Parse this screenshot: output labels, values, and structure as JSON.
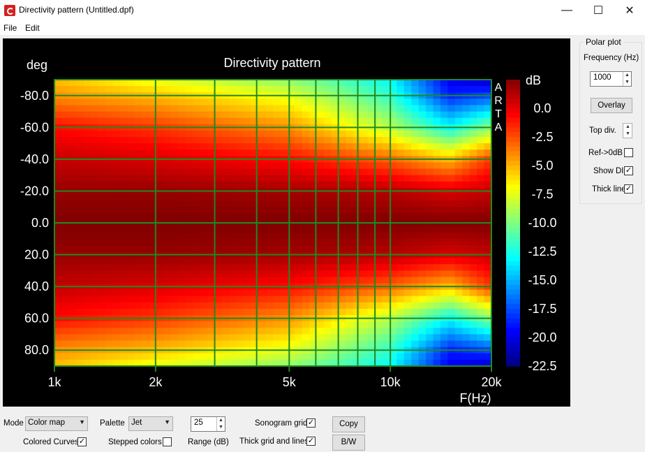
{
  "window": {
    "title": "Directivity pattern (Untitled.dpf)",
    "minimize_glyph": "—",
    "maximize_glyph": "☐",
    "close_glyph": "✕"
  },
  "menu": {
    "items": [
      "File",
      "Edit"
    ]
  },
  "chart_data": {
    "type": "heatmap",
    "title": "Directivity pattern",
    "ylabel": "deg",
    "xlabel": "F(Hz)",
    "watermark": "ARTA",
    "colorbar_label": "dB",
    "x_scale": "log",
    "xlim": [
      1000,
      20000
    ],
    "x_ticks": [
      1000,
      2000,
      5000,
      10000,
      20000
    ],
    "x_tick_labels": [
      "1k",
      "2k",
      "5k",
      "10k",
      "20k"
    ],
    "ylim": [
      -90,
      90
    ],
    "y_ticks": [
      -80,
      -60,
      -40,
      -20,
      0,
      20,
      40,
      60,
      80
    ],
    "y_tick_labels": [
      "-80.0",
      "-60.0",
      "-40.0",
      "-20.0",
      "0.0",
      "20.0",
      "40.0",
      "60.0",
      "80.0"
    ],
    "colorbar_range": [
      -22.5,
      0
    ],
    "colorbar_ticks": [
      "0.0",
      "-2.5",
      "-5.0",
      "-7.5",
      "-10.0",
      "-12.5",
      "-15.0",
      "-17.5",
      "-20.0",
      "-22.5"
    ],
    "palette": "Jet",
    "grid": true,
    "grid_color": "#1f8a1f",
    "freq_hz": [
      1000,
      2000,
      5000,
      10000,
      15000,
      20000
    ],
    "angles_deg": [
      -90,
      -80,
      -60,
      -40,
      -20,
      0,
      20,
      40,
      60,
      80,
      90
    ],
    "values_db": [
      [
        -7,
        -9,
        -11,
        -14,
        -20,
        -21
      ],
      [
        -6,
        -7,
        -9,
        -13,
        -19,
        -18
      ],
      [
        -3,
        -4,
        -6,
        -10,
        -14,
        -11
      ],
      [
        -1.5,
        -2,
        -3,
        -5,
        -7,
        -4
      ],
      [
        -0.5,
        -0.5,
        -0.8,
        -1.2,
        -2,
        -1.5
      ],
      [
        0,
        0,
        0,
        0,
        0,
        0
      ],
      [
        -0.5,
        -0.5,
        -0.8,
        -1.2,
        -2,
        -1.5
      ],
      [
        -1.5,
        -2,
        -3,
        -5,
        -7,
        -4
      ],
      [
        -3,
        -4,
        -6,
        -10,
        -14,
        -11
      ],
      [
        -6,
        -7,
        -9,
        -13,
        -19,
        -18
      ],
      [
        -7,
        -9,
        -11,
        -14,
        -20,
        -21
      ]
    ]
  },
  "polar_plot": {
    "title": "Polar plot",
    "frequency_label": "Frequency (Hz)",
    "frequency_value": "1000",
    "overlay_label": "Overlay",
    "top_div_label": "Top div.",
    "ref_0db_label": "Ref->0dB",
    "ref_0db_checked": false,
    "show_di_label": "Show DI",
    "show_di_checked": true,
    "thick_line_label": "Thick line",
    "thick_line_checked": true
  },
  "bottom": {
    "mode_label": "Mode",
    "mode_value": "Color map",
    "palette_label": "Palette",
    "palette_value": "Jet",
    "range_value": "25",
    "range_label": "Range (dB)",
    "sonogram_grid_label": "Sonogram grid",
    "sonogram_grid_checked": true,
    "copy_label": "Copy",
    "colored_curves_label": "Colored Curves",
    "colored_curves_checked": true,
    "stepped_colors_label": "Stepped colors",
    "stepped_colors_checked": false,
    "thick_grid_label": "Thick grid and  lines",
    "thick_grid_checked": true,
    "bw_label": "B/W"
  },
  "icons": {
    "spin_up": "▲",
    "spin_down": "▼",
    "dropdown": "▼",
    "check": "✓"
  }
}
